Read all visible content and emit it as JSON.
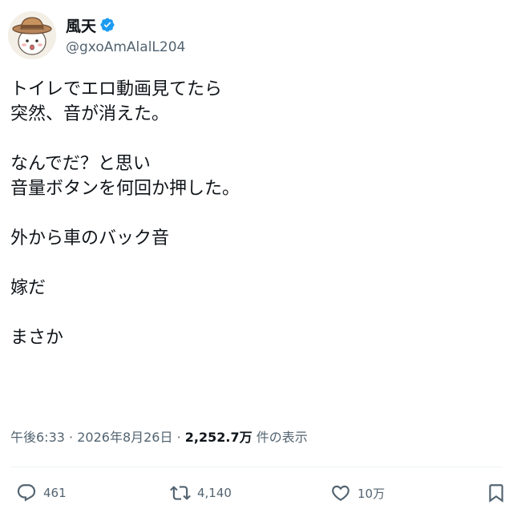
{
  "user": {
    "display_name": "風天",
    "handle": "@gxoAmAlalL204",
    "verified": true,
    "avatar_icon": "cartoon-face-with-hat-avatar"
  },
  "body_lines": [
    "トイレでエロ動画見てたら",
    "突然、音が消えた。",
    "",
    "なんでだ？と思い",
    "音量ボタンを何回か押した。",
    "",
    "外から車のバック音",
    "",
    "嫁だ",
    "",
    "まさか"
  ],
  "meta": {
    "time": "午後6:33",
    "separator": "·",
    "date": "2026年8月26日",
    "views_count": "2,252.7万",
    "views_label": "件の表示"
  },
  "actions": {
    "reply_count": "461",
    "retweet_count": "4,140",
    "like_count": "10万"
  },
  "colors": {
    "text": "#0f1419",
    "secondary": "#536471",
    "verified_blue": "#1d9bf0",
    "divider": "#eff3f4"
  }
}
